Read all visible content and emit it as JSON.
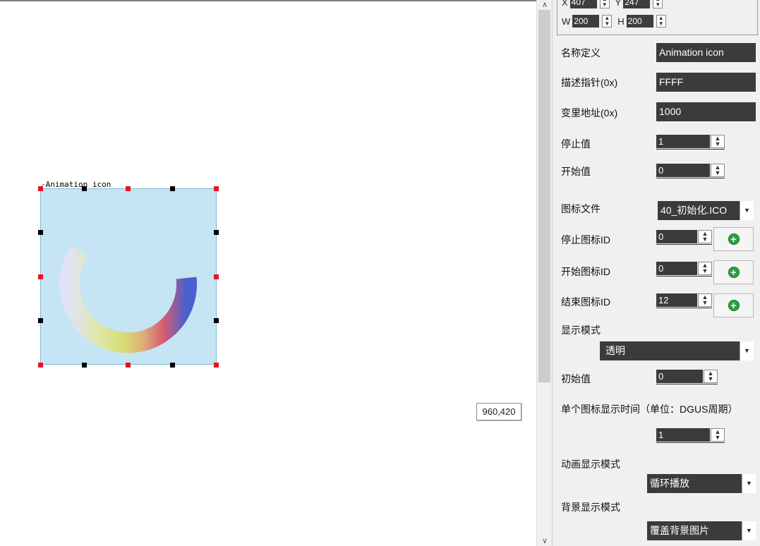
{
  "canvas": {
    "widget_title": "-Animation icon",
    "coord_tooltip": "960,420"
  },
  "panel": {
    "geometry": {
      "x_label": "X",
      "x_value": "407",
      "y_label": "Y",
      "y_value": "247",
      "w_label": "W",
      "w_value": "200",
      "h_label": "H",
      "h_value": "200"
    },
    "name_label": "名称定义",
    "name_value": "Animation icon",
    "desc_ptr_label": "描述指针(0x)",
    "desc_ptr_value": "FFFF",
    "var_addr_label": "变里地址(0x)",
    "var_addr_value": "1000",
    "stop_value_label": "停止值",
    "stop_value": "1",
    "start_value_label": "开始值",
    "start_value": "0",
    "icon_file_label": "图标文件",
    "icon_file_value": "40_初始化.ICO",
    "stop_icon_label": "停止图标ID",
    "stop_icon_value": "0",
    "start_icon_label": "开始图标ID",
    "start_icon_value": "0",
    "end_icon_label": "结束图标ID",
    "end_icon_value": "12",
    "display_mode_label": "显示模式",
    "display_mode_value": "透明",
    "init_value_label": "初始值",
    "init_value": "0",
    "frame_time_label": "单个图标显示时间（单位：DGUS周期）",
    "frame_time_value": "1",
    "anim_mode_label": "动画显示模式",
    "anim_mode_value": "循环播放",
    "bg_mode_label": "背景显示模式",
    "bg_mode_value": "覆盖背景图片"
  },
  "icons": {
    "spin": "up-down-spinner-icon",
    "add": "green-plus-icon",
    "caret": "chevron-down-icon",
    "scroll_up": "scroll-up-arrow-icon",
    "scroll_down": "scroll-down-arrow-icon"
  },
  "colors": {
    "widget_bg": "#c5e5f4",
    "input_bg": "#3b3b3b",
    "handle_red": "#e8141e",
    "add_green": "#2ea043"
  }
}
